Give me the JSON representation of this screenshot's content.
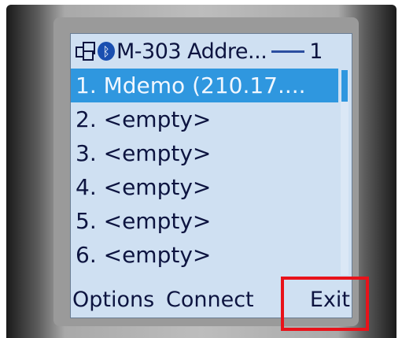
{
  "header": {
    "title": "M-303 Addre...",
    "page_number": "1",
    "app_icon": "windows-icon",
    "bluetooth_icon": "bluetooth-icon"
  },
  "list": {
    "items": [
      "1. Mdemo (210.17....",
      "2. <empty>",
      "3. <empty>",
      "4. <empty>",
      "5. <empty>",
      "6. <empty>"
    ],
    "selected_index": 0
  },
  "softkeys": {
    "left": "Options",
    "center": "Connect",
    "right": "Exit"
  },
  "colors": {
    "screen_bg": "#cfe0f2",
    "selection": "#2f97df",
    "text": "#0d1440",
    "highlight_box": "#e8121a"
  }
}
